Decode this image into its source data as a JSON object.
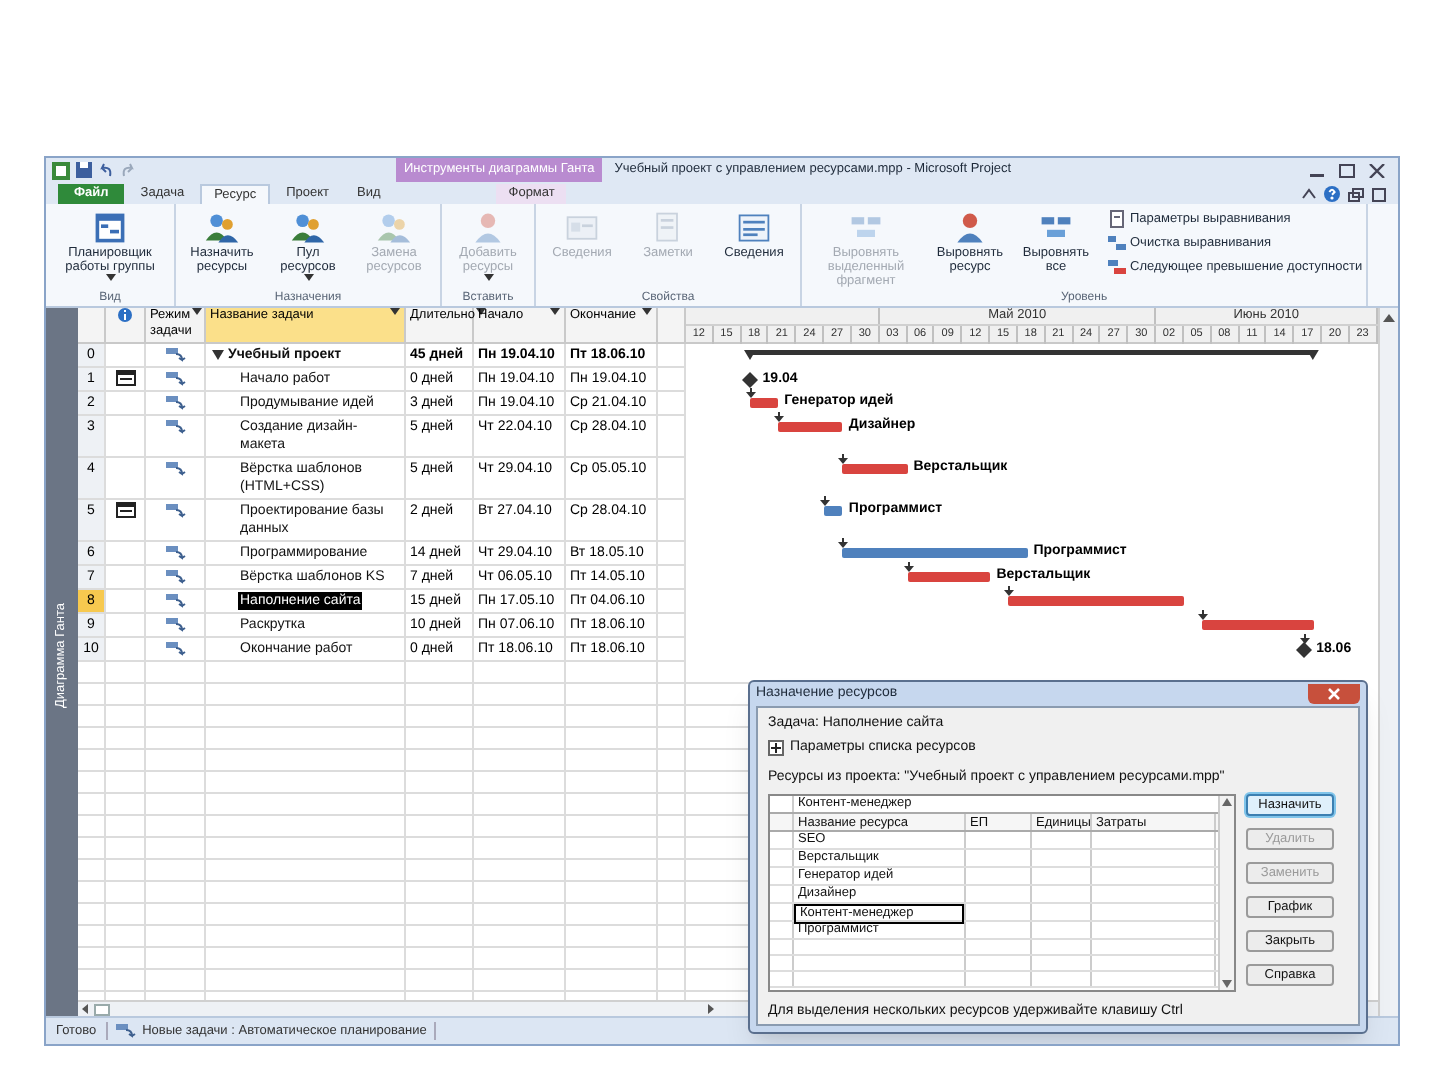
{
  "window": {
    "title": "Учебный проект с управлением ресурсами.mpp - Microsoft Project",
    "context_tab": "Инструменты диаграммы Ганта"
  },
  "ribbon": {
    "tabs": [
      {
        "label": "Файл",
        "kind": "file",
        "selected": false
      },
      {
        "label": "Задача",
        "kind": "tab",
        "selected": false
      },
      {
        "label": "Ресурс",
        "kind": "tab",
        "selected": true
      },
      {
        "label": "Проект",
        "kind": "tab",
        "selected": false
      },
      {
        "label": "Вид",
        "kind": "tab",
        "selected": false
      },
      {
        "label": "Формат",
        "kind": "context",
        "selected": false
      }
    ],
    "groups": [
      {
        "label": "Вид",
        "commands": [
          {
            "label": "Планировщик работы группы",
            "dropdown": true,
            "disabled": false
          }
        ]
      },
      {
        "label": "Назначения",
        "commands": [
          {
            "label": "Назначить ресурсы",
            "dropdown": false,
            "disabled": false
          },
          {
            "label": "Пул ресурсов",
            "dropdown": true,
            "disabled": false
          },
          {
            "label": "Замена ресурсов",
            "dropdown": false,
            "disabled": true
          }
        ]
      },
      {
        "label": "Вставить",
        "commands": [
          {
            "label": "Добавить ресурсы",
            "dropdown": true,
            "disabled": true
          }
        ]
      },
      {
        "label": "Свойства",
        "commands": [
          {
            "label": "Сведения",
            "dropdown": false,
            "disabled": true
          },
          {
            "label": "Заметки",
            "dropdown": false,
            "disabled": true
          },
          {
            "label": "Сведения",
            "dropdown": false,
            "disabled": false
          }
        ]
      },
      {
        "label": "Уровень",
        "commands": [
          {
            "label": "Выровнять выделенный фрагмент",
            "dropdown": false,
            "disabled": true
          },
          {
            "label": "Выровнять ресурс",
            "dropdown": false,
            "disabled": false
          },
          {
            "label": "Выровнять все",
            "dropdown": false,
            "disabled": false
          }
        ],
        "small_commands": [
          {
            "label": "Параметры выравнивания"
          },
          {
            "label": "Очистка выравнивания"
          },
          {
            "label": "Следующее превышение доступности"
          }
        ]
      }
    ]
  },
  "view_bar": {
    "label": "Диаграмма Ганта"
  },
  "table": {
    "columns": [
      {
        "label": "Режим задачи",
        "selected": false
      },
      {
        "label": "Название задачи",
        "selected": true
      },
      {
        "label": "Длительно",
        "selected": false
      },
      {
        "label": "Начало",
        "selected": false
      },
      {
        "label": "Окончание",
        "selected": false
      }
    ],
    "rows": [
      {
        "id": "0",
        "name": "Учебный проект",
        "duration": "45 дней",
        "start": "Пн 19.04.10",
        "finish": "Пт 18.06.10",
        "kind": "summary",
        "expanded": true,
        "indicator": false,
        "selected": false,
        "children": [
          {
            "id": "1",
            "name": "Начало работ",
            "duration": "0 дней",
            "start": "Пн 19.04.10",
            "finish": "Пн 19.04.10",
            "kind": "milestone",
            "indicator": true,
            "selected": false,
            "bar_label": "19.04"
          },
          {
            "id": "2",
            "name": "Продумывание идей",
            "duration": "3 дней",
            "start": "Пн 19.04.10",
            "finish": "Ср 21.04.10",
            "kind": "task",
            "indicator": false,
            "selected": false,
            "color": "#d9443f",
            "bar_label": "Генератор идей"
          },
          {
            "id": "3",
            "name": "Создание дизайн-макета",
            "duration": "5 дней",
            "start": "Чт 22.04.10",
            "finish": "Ср 28.04.10",
            "kind": "task",
            "indicator": false,
            "selected": false,
            "color": "#d9443f",
            "bar_label": "Дизайнер"
          },
          {
            "id": "4",
            "name": "Вёрстка шаблонов (HTML+CSS)",
            "duration": "5 дней",
            "start": "Чт 29.04.10",
            "finish": "Ср 05.05.10",
            "kind": "task",
            "indicator": false,
            "selected": false,
            "color": "#d9443f",
            "bar_label": "Верстальщик"
          },
          {
            "id": "5",
            "name": "Проектирование базы данных",
            "duration": "2 дней",
            "start": "Вт 27.04.10",
            "finish": "Ср 28.04.10",
            "kind": "task",
            "indicator": true,
            "selected": false,
            "color": "#4f81bd",
            "bar_label": "Программист"
          },
          {
            "id": "6",
            "name": "Программирование",
            "duration": "14 дней",
            "start": "Чт 29.04.10",
            "finish": "Вт 18.05.10",
            "kind": "task",
            "indicator": false,
            "selected": false,
            "color": "#4f81bd",
            "bar_label": "Программист"
          },
          {
            "id": "7",
            "name": "Вёрстка шаблонов KS",
            "duration": "7 дней",
            "start": "Чт 06.05.10",
            "finish": "Пт 14.05.10",
            "kind": "task",
            "indicator": false,
            "selected": false,
            "color": "#d9443f",
            "bar_label": "Верстальщик"
          },
          {
            "id": "8",
            "name": "Наполнение сайта",
            "duration": "15 дней",
            "start": "Пн 17.05.10",
            "finish": "Пт 04.06.10",
            "kind": "task",
            "indicator": false,
            "selected": true,
            "color": "#d9443f"
          },
          {
            "id": "9",
            "name": "Раскрутка",
            "duration": "10 дней",
            "start": "Пн 07.06.10",
            "finish": "Пт 18.06.10",
            "kind": "task",
            "indicator": false,
            "selected": false,
            "color": "#d9443f"
          },
          {
            "id": "10",
            "name": "Окончание работ",
            "duration": "0 дней",
            "start": "Пт 18.06.10",
            "finish": "Пт 18.06.10",
            "kind": "milestone",
            "indicator": false,
            "selected": false,
            "bar_label": "18.06"
          }
        ]
      }
    ]
  },
  "gantt": {
    "months": [
      "Май 2010",
      "Июнь 2010"
    ],
    "days": [
      "12",
      "15",
      "18",
      "21",
      "24",
      "27",
      "30",
      "03",
      "06",
      "09",
      "12",
      "15",
      "18",
      "21",
      "24",
      "27",
      "30",
      "02",
      "05",
      "08",
      "11",
      "14",
      "17",
      "20",
      "23"
    ]
  },
  "dialog": {
    "title": "Назначение ресурсов",
    "task": "Задача: Наполнение сайта",
    "options_label": "Параметры списка ресурсов",
    "resources_label": "Ресурсы из проекта: \"Учебный проект с управлением ресурсами.mpp\"",
    "edit_value": "Контент-менеджер",
    "columns": [
      "Название ресурса",
      "ЕП",
      "Единицы",
      "Затраты"
    ],
    "resources": [
      {
        "name": "SEO",
        "selected": false
      },
      {
        "name": "Верстальщик",
        "selected": false
      },
      {
        "name": "Генератор идей",
        "selected": false
      },
      {
        "name": "Дизайнер",
        "selected": false
      },
      {
        "name": "Контент-менеджер",
        "selected": true
      },
      {
        "name": "Программист",
        "selected": false
      }
    ],
    "buttons": [
      {
        "label": "Назначить",
        "kind": "default",
        "disabled": false
      },
      {
        "label": "Удалить",
        "kind": "normal",
        "disabled": true
      },
      {
        "label": "Заменить",
        "kind": "normal",
        "disabled": true
      },
      {
        "label": "График",
        "kind": "normal",
        "disabled": false
      },
      {
        "label": "Закрыть",
        "kind": "normal",
        "disabled": false
      },
      {
        "label": "Справка",
        "kind": "normal",
        "disabled": false
      }
    ],
    "hint": "Для выделения нескольких ресурсов удерживайте клавишу Ctrl"
  },
  "status_bar": {
    "mode": "Готово",
    "new_tasks": "Новые задачи : Автоматическое планирование"
  }
}
